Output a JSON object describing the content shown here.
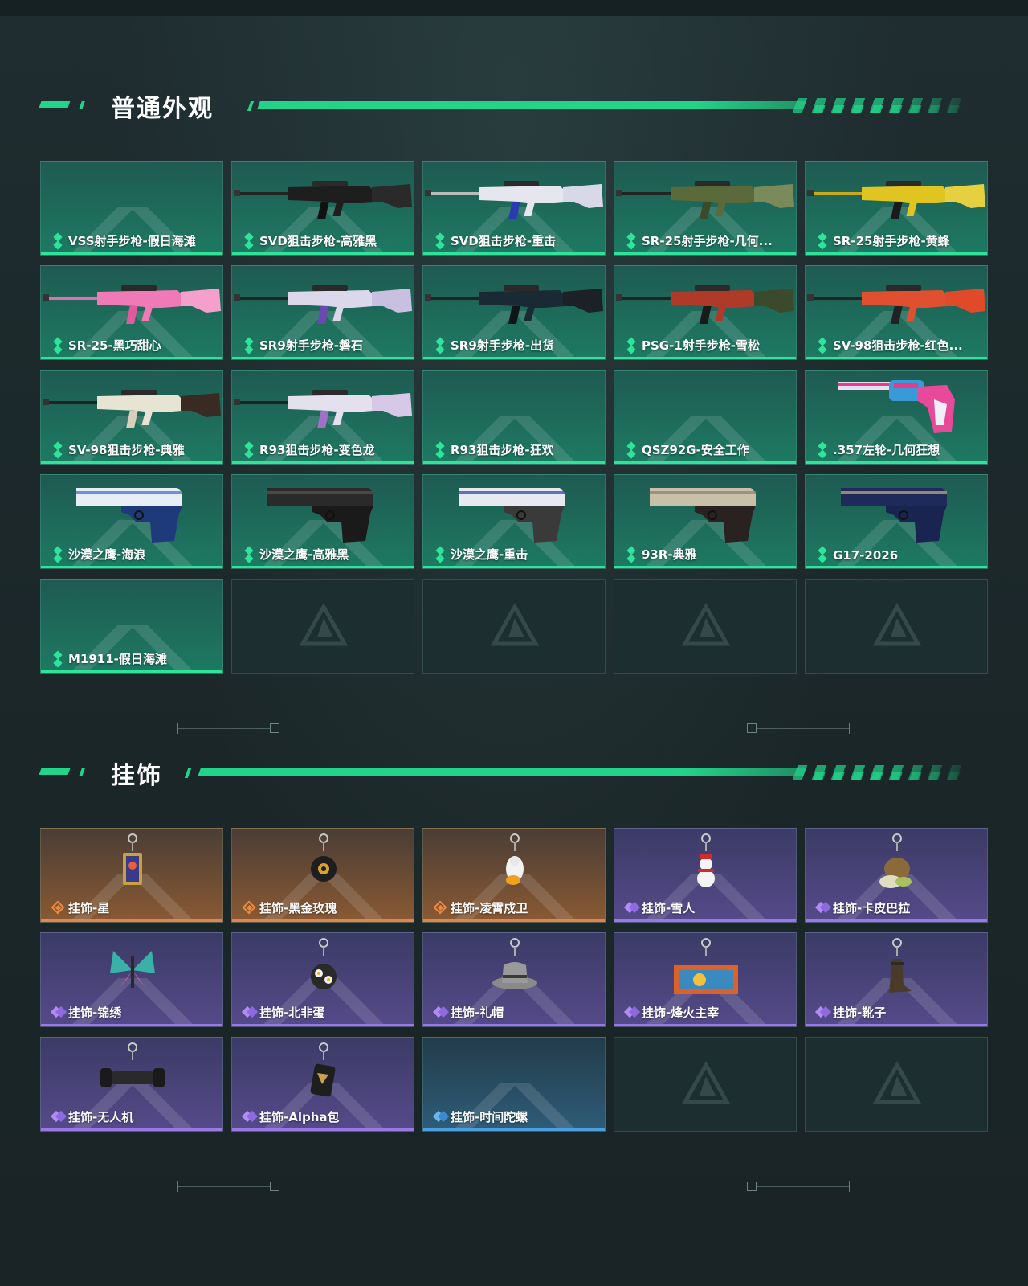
{
  "sections": {
    "skins": {
      "title": "普通外观",
      "items": [
        {
          "label": "VSS射手步枪-假日海滩",
          "rarity": "green",
          "icon": "none"
        },
        {
          "label": "SVD狙击步枪-高雅黑",
          "rarity": "green",
          "icon": "rifle-black"
        },
        {
          "label": "SVD狙击步枪-重击",
          "rarity": "green",
          "icon": "rifle-white-blue"
        },
        {
          "label": "SR-25射手步枪-几何...",
          "rarity": "green",
          "icon": "rifle-camo"
        },
        {
          "label": "SR-25射手步枪-黄蜂",
          "rarity": "green",
          "icon": "rifle-yellow"
        },
        {
          "label": "SR-25-黑巧甜心",
          "rarity": "green",
          "icon": "rifle-pink"
        },
        {
          "label": "SR9射手步枪-磐石",
          "rarity": "green",
          "icon": "rifle-white-purple"
        },
        {
          "label": "SR9射手步枪-出货",
          "rarity": "green",
          "icon": "rifle-dark"
        },
        {
          "label": "PSG-1射手步枪-雪松",
          "rarity": "green",
          "icon": "rifle-red-green"
        },
        {
          "label": "SV-98狙击步枪-红色...",
          "rarity": "green",
          "icon": "rifle-red"
        },
        {
          "label": "SV-98狙击步枪-典雅",
          "rarity": "green",
          "icon": "rifle-cream"
        },
        {
          "label": "R93狙击步枪-变色龙",
          "rarity": "green",
          "icon": "rifle-white-pink"
        },
        {
          "label": "R93狙击步枪-狂欢",
          "rarity": "green",
          "icon": "none"
        },
        {
          "label": "QSZ92G-安全工作",
          "rarity": "green",
          "icon": "none"
        },
        {
          "label": ".357左轮-几何狂想",
          "rarity": "green",
          "icon": "revolver-pink"
        },
        {
          "label": "沙漠之鹰-海浪",
          "rarity": "green",
          "icon": "pistol-blue"
        },
        {
          "label": "沙漠之鹰-高雅黑",
          "rarity": "green",
          "icon": "pistol-black"
        },
        {
          "label": "沙漠之鹰-重击",
          "rarity": "green",
          "icon": "pistol-white"
        },
        {
          "label": "93R-典雅",
          "rarity": "green",
          "icon": "pistol-tan"
        },
        {
          "label": "G17-2026",
          "rarity": "green",
          "icon": "pistol-navy"
        },
        {
          "label": "M1911-假日海滩",
          "rarity": "green",
          "icon": "none"
        },
        {
          "label": "",
          "rarity": "empty",
          "icon": "empty-logo"
        },
        {
          "label": "",
          "rarity": "empty",
          "icon": "empty-logo"
        },
        {
          "label": "",
          "rarity": "empty",
          "icon": "empty-logo"
        },
        {
          "label": "",
          "rarity": "empty",
          "icon": "empty-logo"
        }
      ]
    },
    "charms": {
      "title": "挂饰",
      "items": [
        {
          "label": "挂饰-星",
          "rarity": "gold",
          "icon": "charm-card"
        },
        {
          "label": "挂饰-黑金玫瑰",
          "rarity": "gold",
          "icon": "charm-rose"
        },
        {
          "label": "挂饰-凌霄戍卫",
          "rarity": "gold",
          "icon": "charm-bird"
        },
        {
          "label": "挂饰-雪人",
          "rarity": "purple",
          "icon": "charm-snowman"
        },
        {
          "label": "挂饰-卡皮巴拉",
          "rarity": "purple",
          "icon": "charm-capybara"
        },
        {
          "label": "挂饰-锦绣",
          "rarity": "purple",
          "icon": "charm-butterfly"
        },
        {
          "label": "挂饰-北非蛋",
          "rarity": "purple",
          "icon": "charm-egg-pan"
        },
        {
          "label": "挂饰-礼帽",
          "rarity": "purple",
          "icon": "charm-hat"
        },
        {
          "label": "挂饰-烽火主宰",
          "rarity": "purple",
          "icon": "charm-container"
        },
        {
          "label": "挂饰-靴子",
          "rarity": "purple",
          "icon": "charm-boot"
        },
        {
          "label": "挂饰-无人机",
          "rarity": "purple",
          "icon": "charm-drone"
        },
        {
          "label": "挂饰-Alpha包",
          "rarity": "purple",
          "icon": "charm-pouch"
        },
        {
          "label": "挂饰-时间陀螺",
          "rarity": "blue",
          "icon": "none"
        },
        {
          "label": "",
          "rarity": "empty",
          "icon": "empty-logo"
        },
        {
          "label": "",
          "rarity": "empty",
          "icon": "empty-logo"
        }
      ]
    }
  },
  "colors": {
    "accent_green": "#22d38a",
    "rarity_green": "#2ee39a",
    "rarity_gold": "#e0884a",
    "rarity_purple": "#9a78e8",
    "rarity_blue": "#4aa0e0"
  }
}
